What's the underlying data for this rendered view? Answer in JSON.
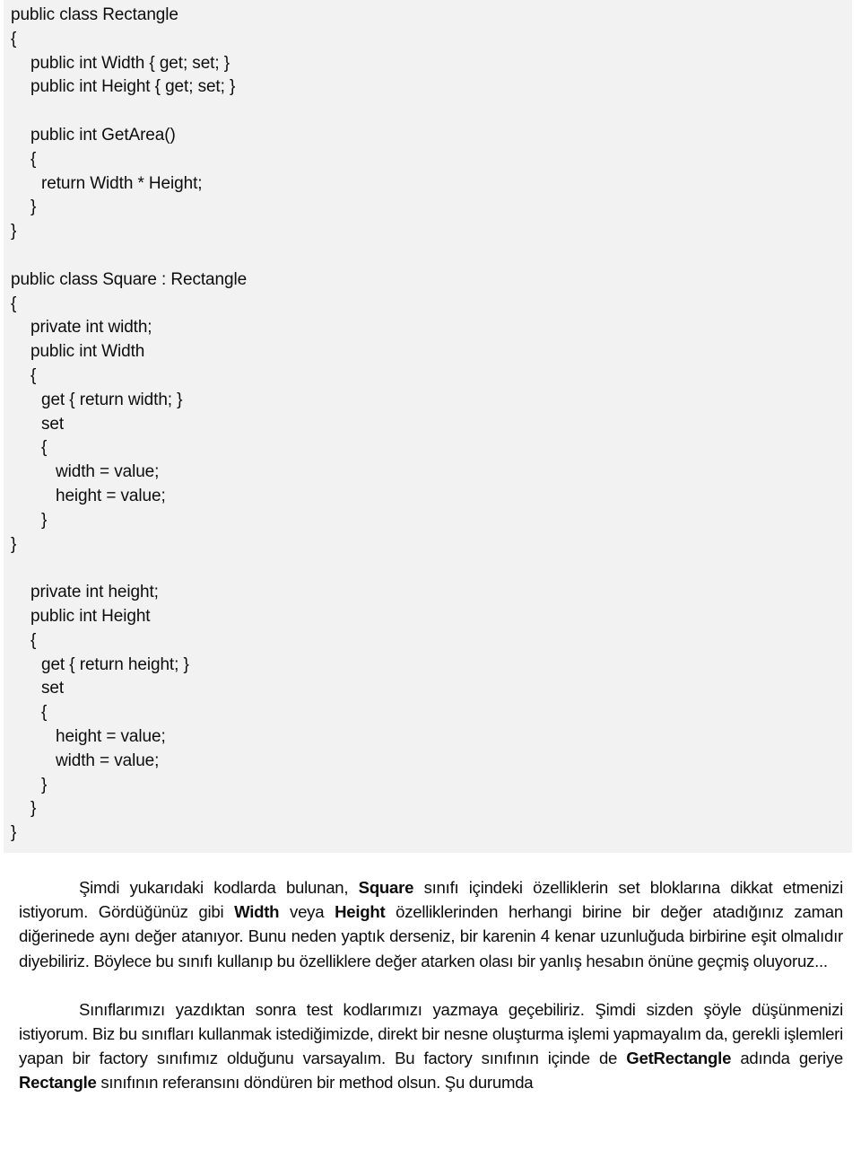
{
  "document": {
    "title": "Square / Rectangle C# Kod Dokümanı",
    "language": "tr",
    "background_color": "#ffffff",
    "code_background_color": "#f2f2f2",
    "text_color": "#0d0d0d"
  },
  "code_block": {
    "language": "csharp",
    "lines": [
      {
        "indent": 0,
        "text": "public class Rectangle"
      },
      {
        "indent": 0,
        "text": "{"
      },
      {
        "indent": 1,
        "text": "public int Width { get; set; }"
      },
      {
        "indent": 1,
        "text": "public int Height { get; set; }"
      },
      {
        "indent": 0,
        "text": ""
      },
      {
        "indent": 1,
        "text": "public int GetArea()"
      },
      {
        "indent": 1,
        "text": "{"
      },
      {
        "indent": 2,
        "text": "return Width * Height;"
      },
      {
        "indent": 1,
        "text": "}"
      },
      {
        "indent": 0,
        "text": "}"
      },
      {
        "indent": 0,
        "text": ""
      },
      {
        "indent": 0,
        "text": "public class Square : Rectangle"
      },
      {
        "indent": 0,
        "text": "{"
      },
      {
        "indent": 1,
        "text": "private int width;"
      },
      {
        "indent": 1,
        "text": "public int Width"
      },
      {
        "indent": 1,
        "text": "{"
      },
      {
        "indent": 2,
        "text": "get { return width; }"
      },
      {
        "indent": 2,
        "text": "set"
      },
      {
        "indent": 2,
        "text": "{"
      },
      {
        "indent": 3,
        "text": "width = value;"
      },
      {
        "indent": 3,
        "text": "height = value;"
      },
      {
        "indent": 2,
        "text": "}"
      },
      {
        "indent": 0,
        "text": "}"
      },
      {
        "indent": 0,
        "text": ""
      },
      {
        "indent": 1,
        "text": "private int height;"
      },
      {
        "indent": 1,
        "text": "public int Height"
      },
      {
        "indent": 1,
        "text": "{"
      },
      {
        "indent": 2,
        "text": "get { return height; }"
      },
      {
        "indent": 2,
        "text": "set"
      },
      {
        "indent": 2,
        "text": "{"
      },
      {
        "indent": 3,
        "text": "height = value;"
      },
      {
        "indent": 3,
        "text": "width = value;"
      },
      {
        "indent": 2,
        "text": "}"
      },
      {
        "indent": 1,
        "text": "}"
      },
      {
        "indent": 0,
        "text": "}"
      }
    ]
  },
  "prose": {
    "paragraphs": [
      {
        "id": "paragraph-1",
        "runs": [
          {
            "bold": false,
            "text": "Şimdi yukarıdaki kodlarda bulunan, "
          },
          {
            "bold": true,
            "text": "Square"
          },
          {
            "bold": false,
            "text": " sınıfı içindeki özelliklerin set bloklarına dikkat etmenizi istiyorum. Gördüğünüz gibi "
          },
          {
            "bold": true,
            "text": "Width"
          },
          {
            "bold": false,
            "text": " veya "
          },
          {
            "bold": true,
            "text": "Height"
          },
          {
            "bold": false,
            "text": " özelliklerinden herhangi birine bir değer atadığınız zaman diğerinede aynı değer atanıyor. Bunu neden yaptık derseniz, bir karenin 4 kenar uzunluğuda birbirine eşit olmalıdır diyebiliriz. Böylece bu sınıfı kullanıp bu özelliklere değer atarken olası bir yanlış hesabın önüne geçmiş oluyoruz..."
          }
        ]
      },
      {
        "id": "paragraph-2",
        "runs": [
          {
            "bold": false,
            "text": "Sınıflarımızı yazdıktan sonra test kodlarımızı yazmaya geçebiliriz. Şimdi sizden şöyle düşünmenizi istiyorum. Biz bu sınıfları kullanmak istediğimizde, direkt bir nesne oluşturma işlemi yapmayalım da, gerekli işlemleri yapan bir factory sınıfımız olduğunu varsayalım. Bu factory sınıfının içinde de "
          },
          {
            "bold": true,
            "text": "GetRectangle"
          },
          {
            "bold": false,
            "text": " adında geriye "
          },
          {
            "bold": true,
            "text": "Rectangle"
          },
          {
            "bold": false,
            "text": " sınıfının referansını döndüren bir method olsun. Şu durumda"
          }
        ]
      }
    ]
  }
}
